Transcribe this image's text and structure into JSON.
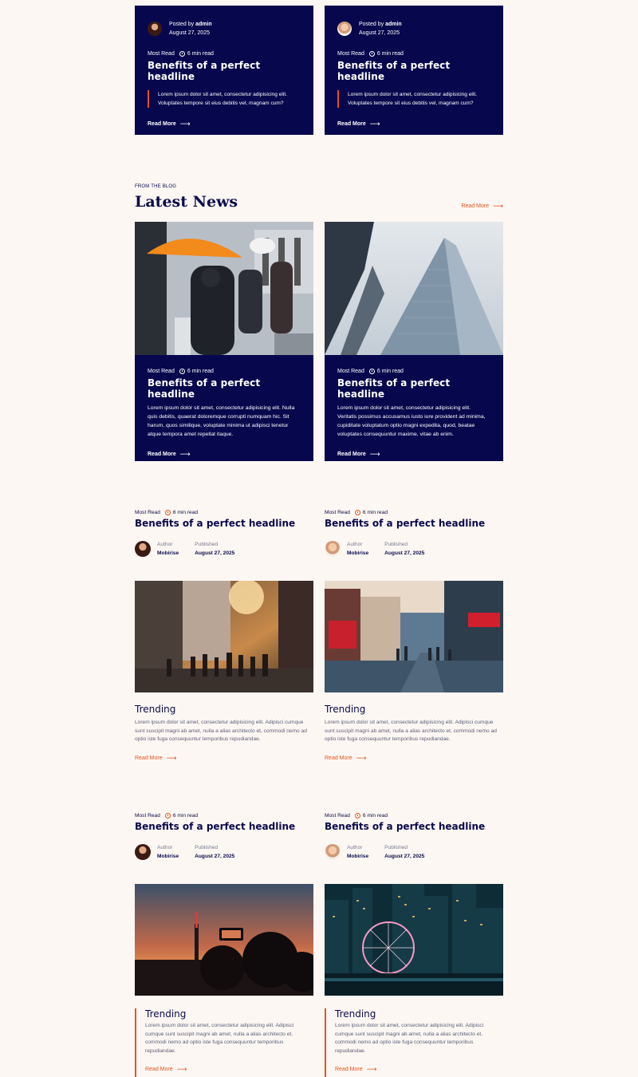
{
  "top_posts": [
    {
      "posted_prefix": "Posted by",
      "author": "admin",
      "date": "August 27, 2025",
      "tag": "Most Read",
      "read_time": "6 min read",
      "headline": "Benefits of a perfect headline",
      "quote": "Lorem ipsum dolor sit amet, consectetur adipisicing elit. Voluptates tempore sit eius debitis vel, magnam cum?",
      "read_more": "Read More"
    },
    {
      "posted_prefix": "Posted by",
      "author": "admin",
      "date": "August 27, 2025",
      "tag": "Most Read",
      "read_time": "6 min read",
      "headline": "Benefits of a perfect headline",
      "quote": "Lorem ipsum dolor sit amet, consectetur adipisicing elit. Voluptates tempore sit eius debitis vel, magnam cum?",
      "read_more": "Read More"
    }
  ],
  "latest": {
    "eyebrow": "FROM THE BLOG",
    "title": "Latest News",
    "read_more": "Read More",
    "cards": [
      {
        "tag": "Most Read",
        "read_time": "6 min read",
        "headline": "Benefits of a perfect headline",
        "text": "Lorem ipsum dolor sit amet, consectetur adipisicing elit. Nulla quis debitis, quaerat doloremque corrupti numquam hic. Sit harum, quos similique, voluptate minima ut adipisci tenetur atque tempora amet repellat itaque.",
        "read_more": "Read More"
      },
      {
        "tag": "Most Read",
        "read_time": "6 min read",
        "headline": "Benefits of a perfect headline",
        "text": "Lorem ipsum dolor sit amet, consectetur adipisicing elit. Veritatis possimus accusamus iusto iure provident ad minima, cupiditate voluptatum optio magni expedita, quod, beatae voluptates consequuntur maxime, vitae ab enim.",
        "read_more": "Read More"
      }
    ]
  },
  "trending_a": [
    {
      "tag": "Most Read",
      "read_time": "6 min read",
      "headline": "Benefits of a perfect headline",
      "author_label": "Author",
      "author": "Mobirise",
      "published_label": "Published",
      "date": "August 27, 2025",
      "trend_title": "Trending",
      "text": "Lorem ipsum dolor sit amet, consectetur adipisicing elit. Adipisci cumque sunt suscipit magni ab amet, nulla a alias architecto et, commodi nemo ad optio iste fuga consequuntur temporibus repudiandae.",
      "read_more": "Read More"
    },
    {
      "tag": "Most Read",
      "read_time": "6 min read",
      "headline": "Benefits of a perfect headline",
      "author_label": "Author",
      "author": "Mobirise",
      "published_label": "Published",
      "date": "August 27, 2025",
      "trend_title": "Trending",
      "text": "Lorem ipsum dolor sit amet, consectetur adipisicing elit. Adipisci cumque sunt suscipit magni ab amet, nulla a alias architecto et, commodi nemo ad optio iste fuga consequuntur temporibus repudiandae.",
      "read_more": "Read More"
    }
  ],
  "trending_b": [
    {
      "tag": "Most Read",
      "read_time": "6 min read",
      "headline": "Benefits of a perfect headline",
      "author_label": "Author",
      "author": "Mobirise",
      "published_label": "Published",
      "date": "August 27, 2025",
      "trend_title": "Trending",
      "text": "Lorem ipsum dolor sit amet, consectetur adipisicing elit. Adipisci cumque sunt suscipit magni ab amet, nulla a alias architecto et, commodi nemo ad optio iste fuga consequuntur temporibus repudiandae.",
      "read_more": "Read More"
    },
    {
      "tag": "Most Read",
      "read_time": "6 min read",
      "headline": "Benefits of a perfect headline",
      "author_label": "Author",
      "author": "Mobirise",
      "published_label": "Published",
      "date": "August 27, 2025",
      "trend_title": "Trending",
      "text": "Lorem ipsum dolor sit amet, consectetur adipisicing elit. Adipisci cumque sunt suscipit magni ab amet, nulla a alias architecto et, commodi nemo ad optio iste fuga consequuntur temporibus repudiandae.",
      "read_more": "Read More"
    }
  ],
  "colors": {
    "navy": "#07074d",
    "accent": "#e8521b",
    "background": "#fdf7f3"
  }
}
